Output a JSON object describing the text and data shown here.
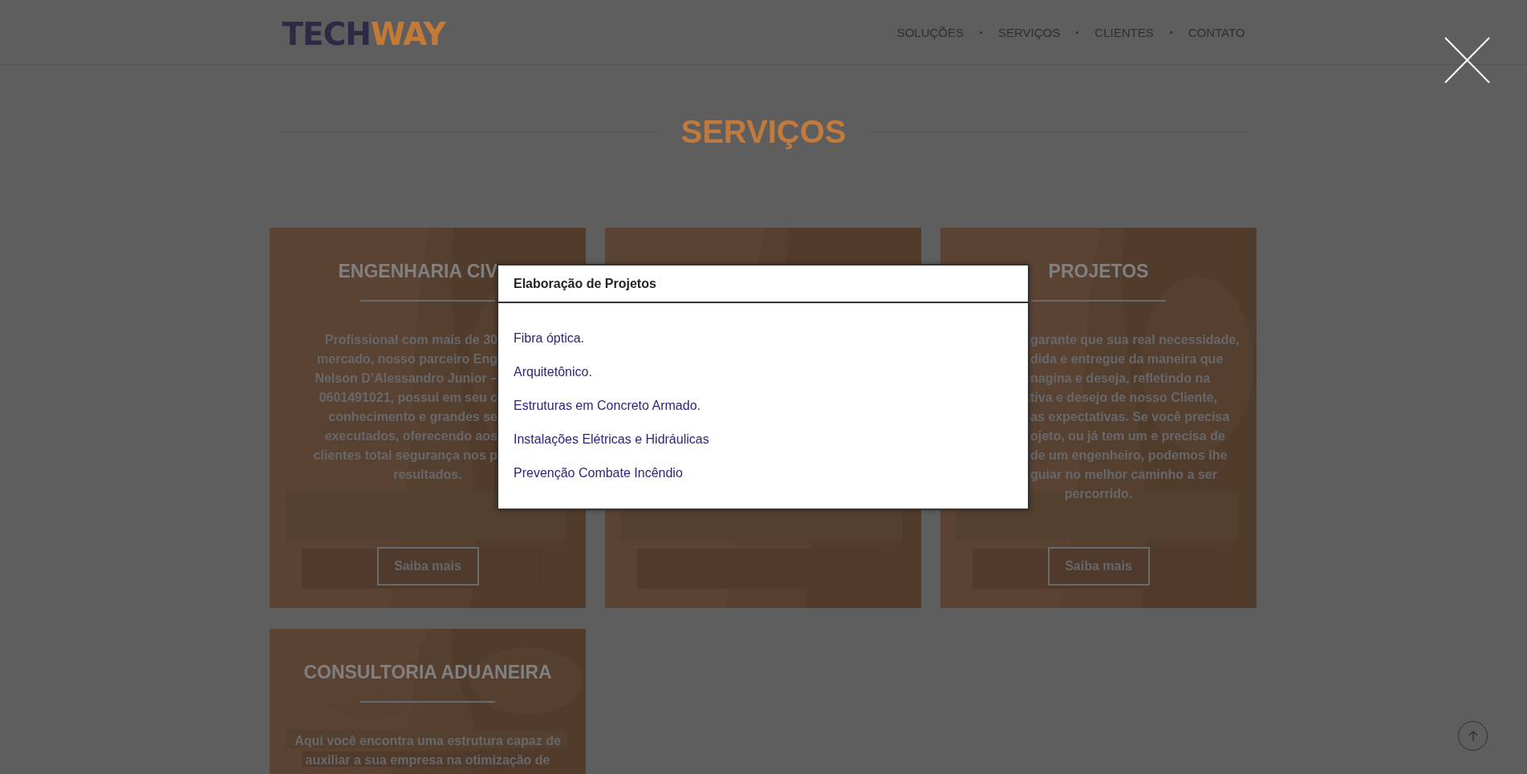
{
  "header": {
    "logo": {
      "part_1": "TECH",
      "part_2": "WAY"
    },
    "nav": [
      {
        "label": "SOLUÇÕES"
      },
      {
        "label": "SERVIÇOS"
      },
      {
        "label": "CLIENTES"
      },
      {
        "label": "CONTATO"
      }
    ]
  },
  "section_title": "SERVIÇOS",
  "cards": [
    {
      "kind": "text",
      "title": {
        "text": "ENGENHARIA CIV",
        "kind": "cut_right"
      },
      "lines": [
        {
          "text": "Profissional com mais de 30",
          "kind": "cut_right"
        },
        {
          "text": "mercado, nosso parceiro Eng",
          "kind": "cut_right"
        },
        {
          "text": "Nelson D’Alessandro Junior –",
          "kind": "cut_right"
        },
        {
          "text": "0601491021, possui em seu c",
          "kind": "cut_right"
        },
        {
          "text": "conhecimento e grandes se",
          "kind": "cut_right"
        },
        {
          "text": "executados, oferecendo aos",
          "kind": "cut_right"
        },
        {
          "text": "clientes total segurança nos p",
          "kind": "cut_right"
        },
        {
          "text": "resultados.",
          "kind": "whole"
        }
      ],
      "button": "Saiba mais"
    },
    {
      "kind": "picture"
    },
    {
      "kind": "text",
      "title": {
        "text": "PROJETOS",
        "kind": "whole"
      },
      "lines": [
        {
          "text": "garante que sua real necessidade,",
          "kind": "cut_left"
        },
        {
          "text": "dida e entregue da maneira que",
          "kind": "cut_left"
        },
        {
          "text": "nagina e deseja, refletindo na",
          "kind": "cut_left"
        },
        {
          "text": "tiva e desejo de nosso Cliente,",
          "kind": "cut_left"
        },
        {
          "text": "as expectativas. Se você precisa",
          "kind": "cut_left"
        },
        {
          "text": "ojeto, ou já tem um e precisa de",
          "kind": "cut_left"
        },
        {
          "text": "de um engenheiro, podemos lhe",
          "kind": "cut_left"
        },
        {
          "text": "guiar no melhor caminho a ser",
          "kind": "cut_left"
        },
        {
          "text": "percorrido.",
          "kind": "whole"
        }
      ],
      "button": "Saiba mais"
    },
    {
      "kind": "text",
      "title": {
        "text": "CONSULTORIA ADUANEIRA",
        "kind": "whole"
      },
      "lines": [
        {
          "text": "Aqui você encontra uma estrutura capaz de",
          "kind": "whole"
        },
        {
          "text": "auxiliar a sua empresa na otimização de",
          "kind": "whole"
        }
      ]
    }
  ],
  "modal": {
    "title": "Elaboração de Projetos",
    "items": [
      "Fibra óptica.",
      "Arquitetônico.",
      "Estruturas em Concreto Armado.",
      "Instalações Elétricas e Hidráulicas",
      "Prevenção Combate Incêndio"
    ]
  }
}
